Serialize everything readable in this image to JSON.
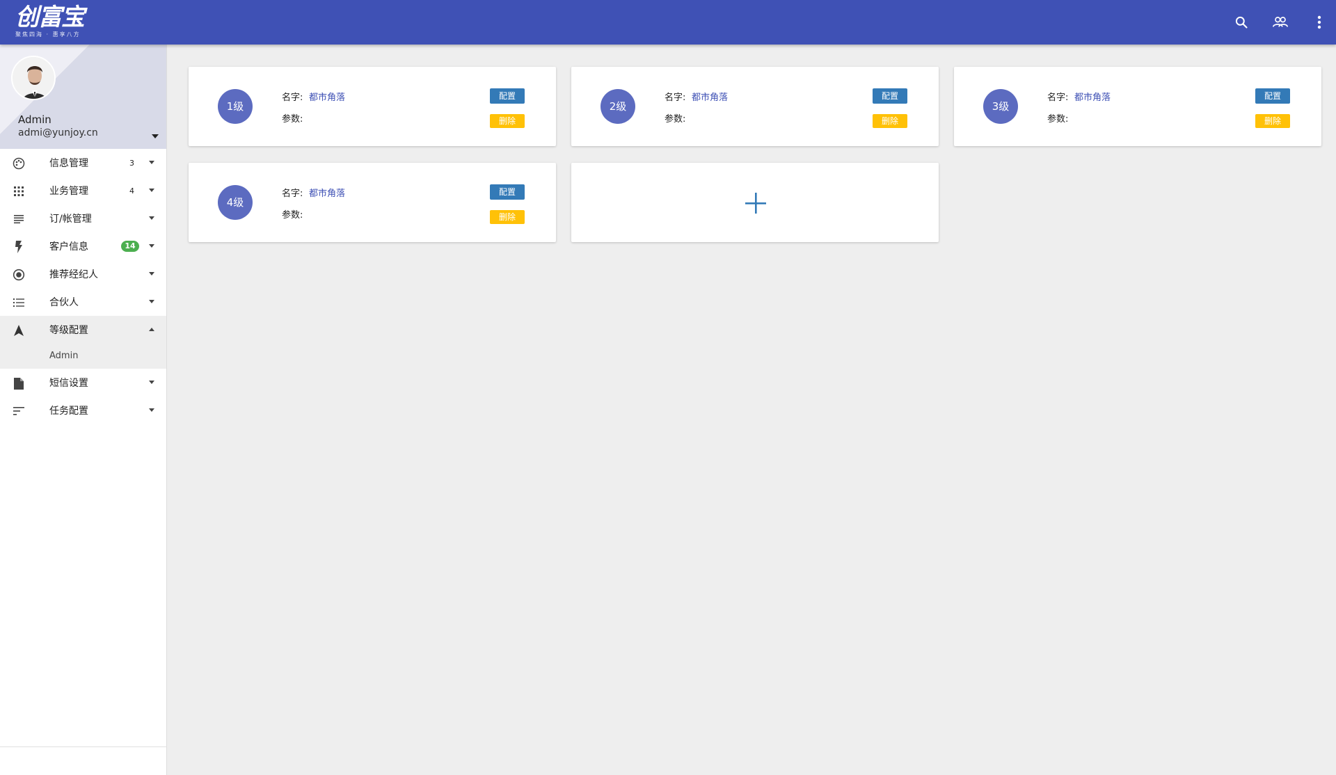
{
  "header": {
    "logo_title": "创富宝",
    "logo_sub": "聚焦四海 · 惠享八方",
    "icons": [
      "search-icon",
      "people-icon",
      "more-vert-icon"
    ],
    "bar_color": "#3f51b5"
  },
  "profile": {
    "name": "Admin",
    "email": "admi@yunjoy.cn"
  },
  "sidebar": {
    "items": [
      {
        "label": "信息管理",
        "icon": "palette-icon",
        "count": "3"
      },
      {
        "label": "业务管理",
        "icon": "apps-icon",
        "count": "4"
      },
      {
        "label": "订/帐管理",
        "icon": "notes-icon"
      },
      {
        "label": "客户信息",
        "icon": "flash-icon",
        "badge": "14"
      },
      {
        "label": "推荐经纪人",
        "icon": "radio-icon"
      },
      {
        "label": "合伙人",
        "icon": "list-icon"
      },
      {
        "label": "等级配置",
        "icon": "navigation-icon",
        "expanded": true
      },
      {
        "label": "短信设置",
        "icon": "file-icon"
      },
      {
        "label": "任务配置",
        "icon": "sort-icon"
      }
    ],
    "sub_item": "Admin",
    "badge_color": "#4caf50"
  },
  "cards": [
    {
      "level": "1级",
      "name_label": "名字:",
      "name_value": "都市角落",
      "param_label": "参数:",
      "config": "配置",
      "delete": "删除"
    },
    {
      "level": "2级",
      "name_label": "名字:",
      "name_value": "都市角落",
      "param_label": "参数:",
      "config": "配置",
      "delete": "删除"
    },
    {
      "level": "3级",
      "name_label": "名字:",
      "name_value": "都市角落",
      "param_label": "参数:",
      "config": "配置",
      "delete": "删除"
    },
    {
      "level": "4级",
      "name_label": "名字:",
      "name_value": "都市角落",
      "param_label": "参数:",
      "config": "配置",
      "delete": "删除"
    }
  ],
  "colors": {
    "level_badge": "#5c6bc0",
    "config_button": "#337ab7",
    "delete_button": "#ffc107"
  }
}
